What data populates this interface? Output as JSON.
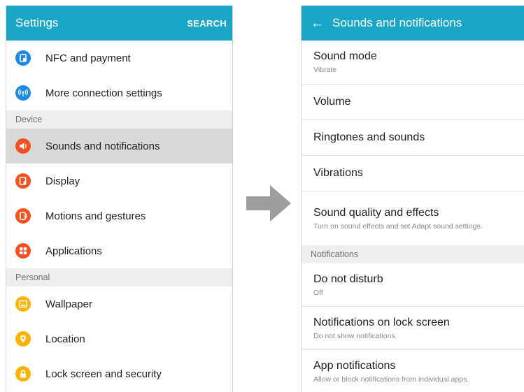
{
  "left": {
    "header": {
      "title": "Settings",
      "search_label": "SEARCH"
    },
    "items_top": [
      {
        "label": "NFC and payment",
        "icon": "nfc-icon",
        "color": "#1e88e5"
      },
      {
        "label": "More connection settings",
        "icon": "connection-icon",
        "color": "#1e88e5"
      }
    ],
    "section_device": "Device",
    "items_device": [
      {
        "label": "Sounds and notifications",
        "icon": "speaker-icon",
        "color": "#f4511e",
        "selected": true
      },
      {
        "label": "Display",
        "icon": "display-icon",
        "color": "#f4511e"
      },
      {
        "label": "Motions and gestures",
        "icon": "motion-icon",
        "color": "#f4511e"
      },
      {
        "label": "Applications",
        "icon": "apps-grid-icon",
        "color": "#f4511e"
      }
    ],
    "section_personal": "Personal",
    "items_personal": [
      {
        "label": "Wallpaper",
        "icon": "wallpaper-icon",
        "color": "#ffb300"
      },
      {
        "label": "Location",
        "icon": "location-pin-icon",
        "color": "#ffb300"
      },
      {
        "label": "Lock screen and security",
        "icon": "lock-icon",
        "color": "#ffb300"
      }
    ]
  },
  "arrow_icon": "right-arrow-icon",
  "right": {
    "header": {
      "title": "Sounds and notifications"
    },
    "items": [
      {
        "title": "Sound mode",
        "subtitle": "Vibrate"
      },
      {
        "title": "Volume",
        "subtitle": ""
      },
      {
        "title": "Ringtones and sounds",
        "subtitle": ""
      },
      {
        "title": "Vibrations",
        "subtitle": ""
      },
      {
        "title": "Sound quality and effects",
        "subtitle": "Turn on sound effects and set Adapt sound settings."
      }
    ],
    "section_notifications": "Notifications",
    "notif_items": [
      {
        "title": "Do not disturb",
        "subtitle": "Off"
      },
      {
        "title": "Notifications on lock screen",
        "subtitle": "Do not show notifications"
      },
      {
        "title": "App notifications",
        "subtitle": "Allow or block notifications from individual apps."
      }
    ]
  }
}
